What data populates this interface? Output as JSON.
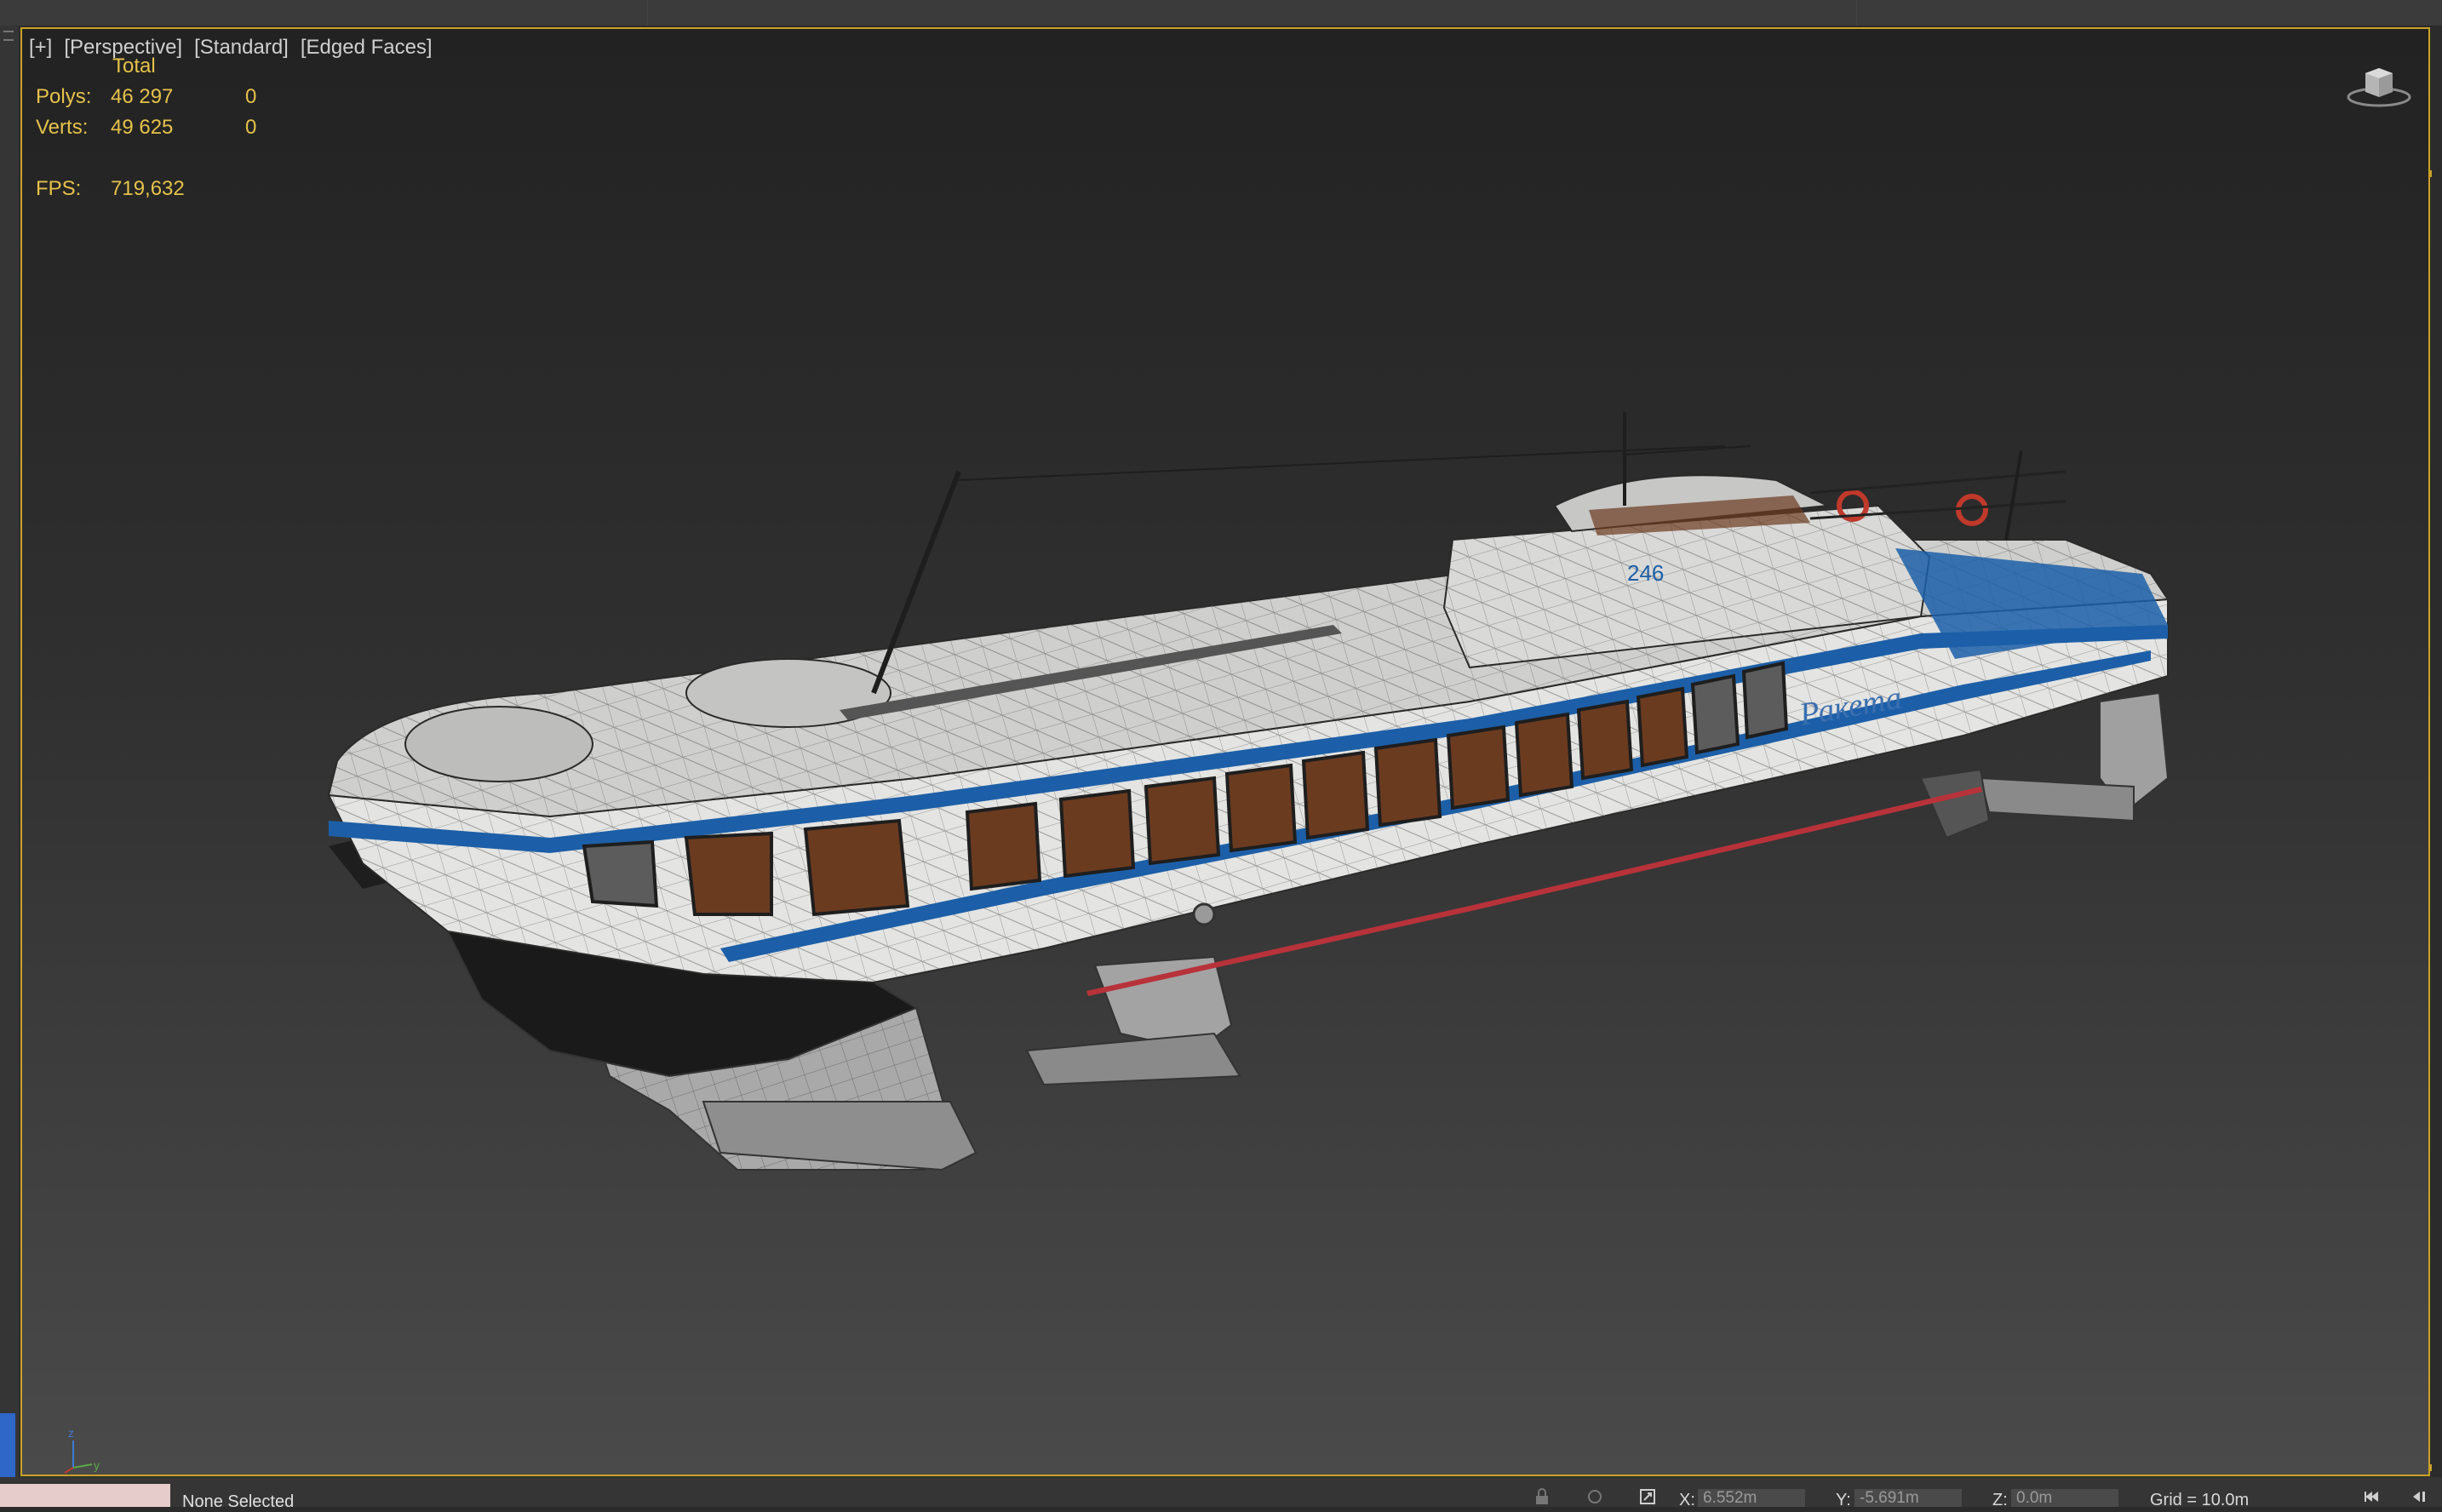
{
  "viewport": {
    "labels": [
      "[+]",
      "[Perspective]",
      "[Standard]",
      "[Edged Faces]"
    ],
    "stats": {
      "header": "Total",
      "polys_label": "Polys:",
      "polys_total": "46 297",
      "polys_selected": "0",
      "verts_label": "Verts:",
      "verts_total": "49 625",
      "verts_selected": "0",
      "fps_label": "FPS:",
      "fps_value": "719,632"
    },
    "model_text": {
      "hull_name": "Ракета",
      "number": "246"
    },
    "colors": {
      "stats_text": "#e6c24a",
      "border_active": "#c9a227",
      "hull_white": "#e4e4e2",
      "stripe_blue": "#1c5fa8",
      "stripe_red": "#b8323a"
    }
  },
  "status_bar": {
    "selection": "None Selected",
    "x_label": "X:",
    "x_value": "6.552m",
    "y_label": "Y:",
    "y_value": "-5.691m",
    "z_label": "Z:",
    "z_value": "0.0m",
    "grid": "Grid = 10.0m"
  },
  "icons": [
    "viewcube-icon",
    "axis-tripod-icon",
    "lock-icon",
    "selection-lock-icon",
    "absolute-mode-icon",
    "go-to-start-icon",
    "play-icon"
  ]
}
